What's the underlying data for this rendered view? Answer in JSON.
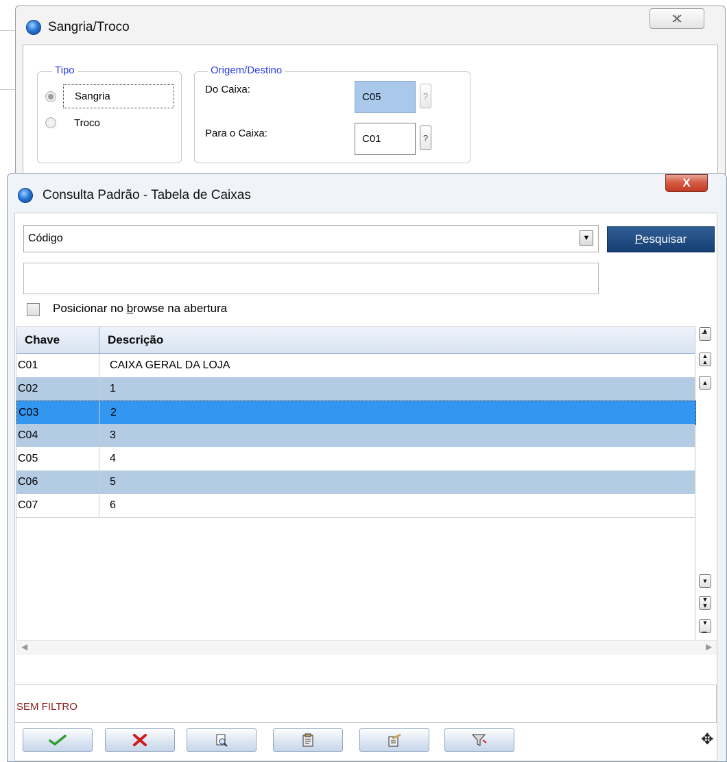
{
  "sangria_dialog": {
    "title": "Sangria/Troco",
    "close_icon": "close-icon",
    "tipo_group": {
      "legend": "Tipo",
      "options": [
        {
          "label": "Sangria",
          "selected": true
        },
        {
          "label": "Troco",
          "selected": false
        }
      ]
    },
    "origem_group": {
      "legend": "Origem/Destino",
      "do_caixa_label": "Do Caixa:",
      "do_caixa_value": "C05",
      "para_caixa_label": "Para o Caixa:",
      "para_caixa_value": "C01",
      "help_label": "?"
    }
  },
  "consulta_dialog": {
    "title": "Consulta Padrão - Tabela de Caixas",
    "close_label": "X",
    "order_select_value": "Código",
    "search_button": {
      "accel": "P",
      "rest": "esquisar"
    },
    "search_value": "",
    "position_checkbox": {
      "pre": "Posicionar no ",
      "accel": "b",
      "post": "rowse na abertura",
      "checked": false
    },
    "columns": [
      "Chave",
      "Descrição"
    ],
    "rows": [
      {
        "chave": "C01",
        "descricao": "CAIXA GERAL DA LOJA"
      },
      {
        "chave": "C02",
        "descricao": "1"
      },
      {
        "chave": "C03",
        "descricao": "2"
      },
      {
        "chave": "C04",
        "descricao": "3"
      },
      {
        "chave": "C05",
        "descricao": "4"
      },
      {
        "chave": "C06",
        "descricao": "5"
      },
      {
        "chave": "C07",
        "descricao": "6"
      }
    ],
    "selected_row": "C03",
    "status_text": "SEM FILTRO",
    "toolbar": [
      "confirm-check-icon",
      "cancel-x-icon",
      "view-details-icon",
      "edit-record-icon",
      "new-record-icon",
      "filter-icon"
    ],
    "colors": {
      "title_bg": "#f0f4f8",
      "row_alt": "#b4cbe4",
      "row_selected": "#3396f0",
      "search_button_bg": "#1d4b82",
      "status_text": "#8b1a1a",
      "legend_text": "#2a3de0"
    }
  }
}
